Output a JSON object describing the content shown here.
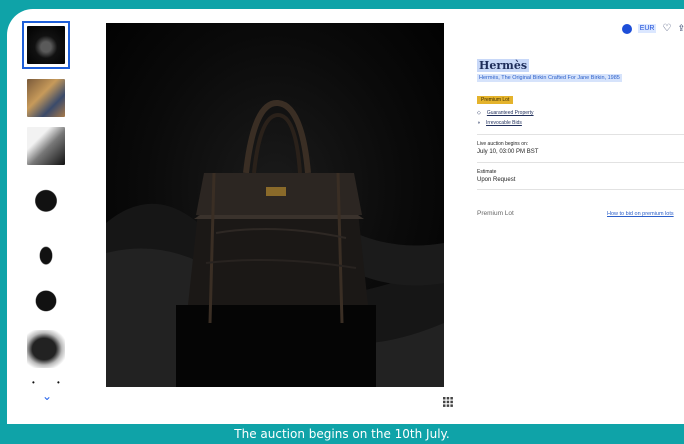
{
  "header": {
    "currency": "EUR"
  },
  "lot": {
    "title": "Hermès",
    "subtitle": "Hermès, The Original Birkin Crafted For Jane Birkin, 1985",
    "badge": "Premium Lot",
    "guarantee": "Guaranteed Property",
    "irrevocable": "Irrevocable Bids",
    "auction_label": "Live auction begins on:",
    "auction_date": "July 10, 03:00 PM BST",
    "estimate_label": "Estimate",
    "estimate_value": "Upon Request",
    "premium_label": "Premium Lot",
    "premium_link": "How to bid on premium lots"
  },
  "gallery": {
    "thumbnail_count": 7,
    "dots": "• •"
  },
  "caption": "The auction begins on the 10th July.",
  "colors": {
    "accent": "#1d4ed8",
    "badge": "#e4b32c",
    "border": "#0fa3a8"
  }
}
